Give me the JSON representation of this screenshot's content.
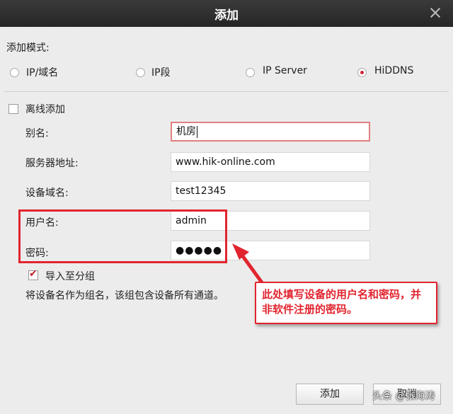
{
  "dialog": {
    "title": "添加"
  },
  "mode": {
    "label": "添加模式:",
    "options": [
      {
        "label": "IP/域名",
        "selected": false
      },
      {
        "label": "IP段",
        "selected": false
      },
      {
        "label": "IP Server",
        "selected": false
      },
      {
        "label": "HiDDNS",
        "selected": true
      }
    ]
  },
  "offline": {
    "label": "离线添加",
    "checked": false
  },
  "form": {
    "alias": {
      "label": "别名:",
      "value": "机房"
    },
    "server": {
      "label": "服务器地址:",
      "value": "www.hik-online.com"
    },
    "domain": {
      "label": "设备域名:",
      "value": "test12345"
    },
    "username": {
      "label": "用户名:",
      "value": "admin"
    },
    "password": {
      "label": "密码:",
      "value": "●●●●●"
    }
  },
  "group": {
    "label": "导入至分组",
    "checked": true,
    "note": "将设备名作为组名，该组包含设备所有通道。"
  },
  "annotation": {
    "text": "此处填写设备的用户名和密码，并非软件注册的密码。"
  },
  "buttons": {
    "add": "添加",
    "cancel": "取消"
  },
  "watermark": "头条 @张海涛",
  "colors": {
    "accent": "#e1252f",
    "radio_selected": "#d4223b"
  }
}
